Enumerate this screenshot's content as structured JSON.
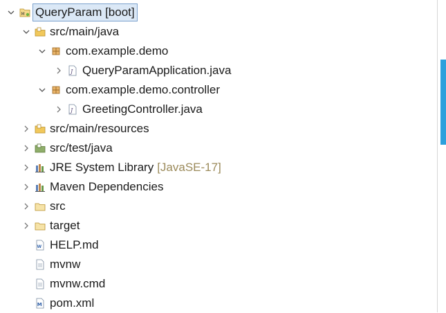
{
  "tree": {
    "project": {
      "label": "QueryParam [boot]"
    },
    "src_main_java": {
      "label": "src/main/java"
    },
    "pkg_demo": {
      "label": "com.example.demo"
    },
    "file_app": {
      "label": "QueryParamApplication.java"
    },
    "pkg_controller": {
      "label": "com.example.demo.controller"
    },
    "file_greeting": {
      "label": "GreetingController.java"
    },
    "src_main_resources": {
      "label": "src/main/resources"
    },
    "src_test_java": {
      "label": "src/test/java"
    },
    "jre": {
      "label": "JRE System Library",
      "decoration": "[JavaSE-17]"
    },
    "maven_deps": {
      "label": "Maven Dependencies"
    },
    "src": {
      "label": "src"
    },
    "target": {
      "label": "target"
    },
    "help": {
      "label": "HELP.md"
    },
    "mvnw": {
      "label": "mvnw"
    },
    "mvnw_cmd": {
      "label": "mvnw.cmd"
    },
    "pom": {
      "label": "pom.xml"
    }
  },
  "colors": {
    "selection_bg": "#dbe8f6",
    "selection_border": "#7da2ce",
    "decoration_text": "#9b8a5a",
    "scrollbar_thumb": "#2ca0dc"
  }
}
